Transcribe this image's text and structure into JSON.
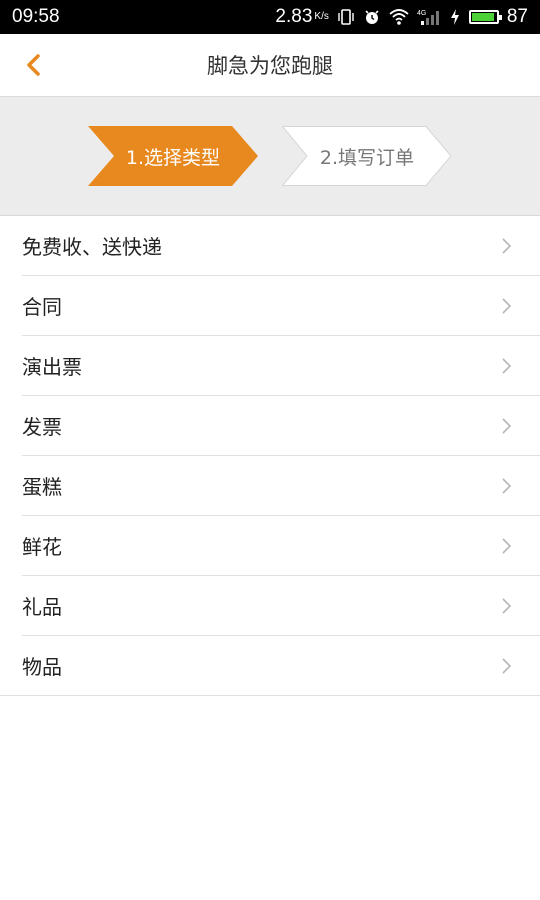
{
  "status_bar": {
    "time": "09:58",
    "speed_value": "2.83",
    "speed_unit": "K/s",
    "battery": "87",
    "battery_level": 0.87
  },
  "header": {
    "title": "脚急为您跑腿",
    "back_icon": "chevron-left-icon"
  },
  "steps": [
    {
      "label": "1.选择类型",
      "active": true
    },
    {
      "label": "2.填写订单",
      "active": false
    }
  ],
  "colors": {
    "accent": "#e8891f",
    "step_inactive_bg": "#ffffff",
    "page_bg": "#ececec"
  },
  "list": [
    {
      "label": "免费收、送快递"
    },
    {
      "label": "合同"
    },
    {
      "label": "演出票"
    },
    {
      "label": "发票"
    },
    {
      "label": "蛋糕"
    },
    {
      "label": "鲜花"
    },
    {
      "label": "礼品"
    },
    {
      "label": "物品"
    }
  ]
}
